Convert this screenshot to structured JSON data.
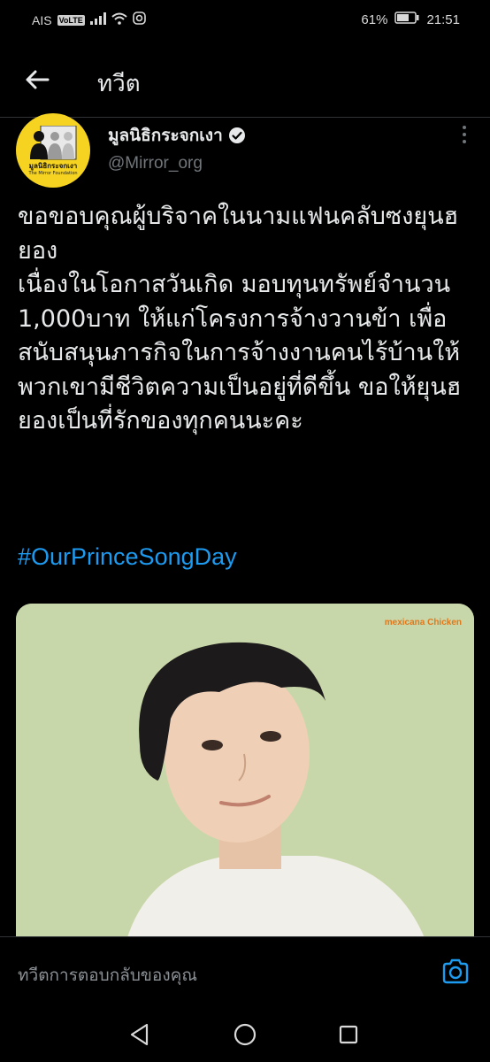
{
  "status_bar": {
    "carrier": "AIS",
    "volte": "VoLTE",
    "battery_percent": "61%",
    "time": "21:51"
  },
  "header": {
    "title": "ทวีต"
  },
  "tweet": {
    "author_name": "มูลนิธิกระจกเงา",
    "author_handle": "@Mirror_org",
    "avatar_text": "มูลนิธิกระจกเงา",
    "avatar_subtext": "The Mirror Foundation",
    "text": "ขอขอบคุณผู้บริจาคในนามแฟนคลับซงยุนฮยอง\nเนื่องในโอกาสวันเกิด มอบทุนทรัพย์จำนวน 1,000บาท ให้แก่โครงการจ้างวานข้า เพื่อสนับสนุนภารกิจในการจ้างงานคนไร้บ้านให้พวกเขามีชีวิตความเป็นอยู่ที่ดีขึ้น ขอให้ยุนฮยองเป็นที่รักของทุกคนนะคะ",
    "hashtag": "#OurPrinceSongDay",
    "media_brand": "mexicana Chicken"
  },
  "reply_bar": {
    "placeholder": "ทวีตการตอบกลับของคุณ"
  },
  "colors": {
    "background": "#000000",
    "hashtag": "#1d9bf0",
    "avatar_bg": "#f5d320",
    "media_bg": "#c8d7a9"
  }
}
